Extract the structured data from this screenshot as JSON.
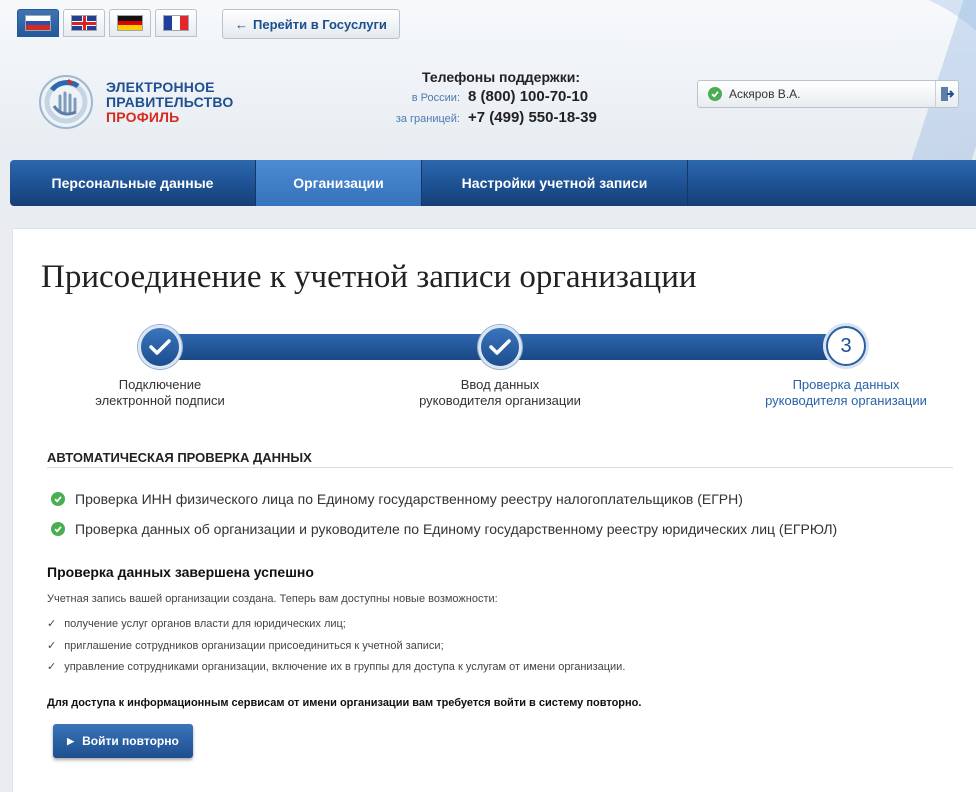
{
  "header": {
    "languages": [
      {
        "name": "russian-flag",
        "active": true
      },
      {
        "name": "uk-flag",
        "active": false
      },
      {
        "name": "german-flag",
        "active": false
      },
      {
        "name": "french-flag",
        "active": false
      }
    ],
    "goto_arrow": "←",
    "goto_label": "Перейти в Госуслуги",
    "logo_line1": "ЭЛЕКТРОННОЕ",
    "logo_line2": "ПРАВИТЕЛЬСТВО",
    "logo_line3": "ПРОФИЛЬ",
    "support_title": "Телефоны поддержки:",
    "support": [
      {
        "label": "в России:",
        "number": "8 (800) 100-70-10"
      },
      {
        "label": "за границей:",
        "number": "+7 (499) 550-18-39"
      }
    ],
    "user_name": "Аскяров В.А."
  },
  "nav": [
    {
      "label": "Персональные данные",
      "active": false
    },
    {
      "label": "Организации",
      "active": true
    },
    {
      "label": "Настройки учетной записи",
      "active": false
    }
  ],
  "main": {
    "title": "Присоединение к учетной записи организации",
    "steps": [
      {
        "label1": "Подключение",
        "label2": "электронной подписи",
        "status": "done"
      },
      {
        "label1": "Ввод данных",
        "label2": "руководителя организации",
        "status": "done"
      },
      {
        "label1": "Проверка данных",
        "label2": "руководителя организации",
        "status": "current",
        "number": "3"
      }
    ],
    "section_heading": "АВТОМАТИЧЕСКАЯ ПРОВЕРКА ДАННЫХ",
    "checks": [
      "Проверка ИНН физического лица по Единому государственному реестру налогоплательщиков (ЕГРН)",
      "Проверка данных об организации и руководителе по Единому государственному реестру юридических лиц (ЕГРЮЛ)"
    ],
    "success_heading": "Проверка данных завершена успешно",
    "success_text": "Учетная запись вашей организации создана. Теперь вам доступны новые возможности:",
    "capabilities": [
      "получение услуг органов власти для юридических лиц;",
      "приглашение сотрудников организации присоединиться к учетной записи;",
      "управление сотрудниками организации, включение их в группы для доступа к услугам от имени организации."
    ],
    "relogin_note": "Для доступа к информационным сервисам от имени организации вам требуется войти в систему повторно.",
    "relogin_button": "Войти повторно"
  },
  "colors": {
    "brand_blue": "#1e4f8f",
    "nav_active": "#3473bd",
    "ok_green": "#49ad52",
    "accent_red": "#d52b1e"
  }
}
